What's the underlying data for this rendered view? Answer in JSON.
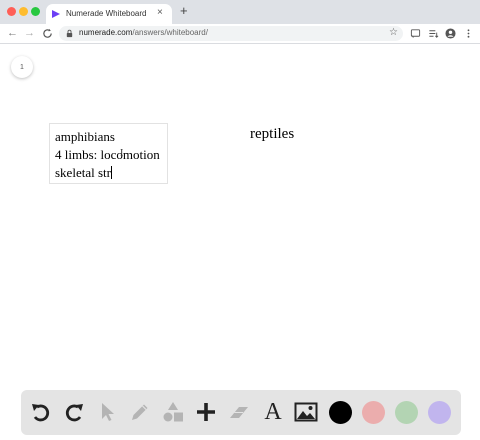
{
  "browser": {
    "tab_title": "Numerade Whiteboard",
    "tab_close": "×",
    "new_tab": "+",
    "url_host": "numerade.com",
    "url_path": "/answers/whiteboard/",
    "nav_back": "←",
    "nav_forward": "→",
    "nav_reload": "C",
    "bookmark_star": "☆",
    "colors": {
      "tab_bar": "#dee1e6",
      "brand_favicon": "#6c3ff5"
    }
  },
  "whiteboard": {
    "page_number": "1",
    "textbox_lines": [
      "amphibians",
      "4 limbs: locomotion",
      "skeletal str"
    ],
    "cursor_glyph": "I",
    "label": "reptiles"
  },
  "tools": {
    "items": [
      "undo-icon",
      "redo-icon",
      "select-icon",
      "pencil-icon",
      "shapes-icon",
      "add-icon",
      "eraser-icon",
      "text-icon",
      "image-icon"
    ],
    "text_glyph": "A",
    "colors": [
      "#000000",
      "#ebadad",
      "#b3d4b3",
      "#c1b5ee"
    ]
  }
}
